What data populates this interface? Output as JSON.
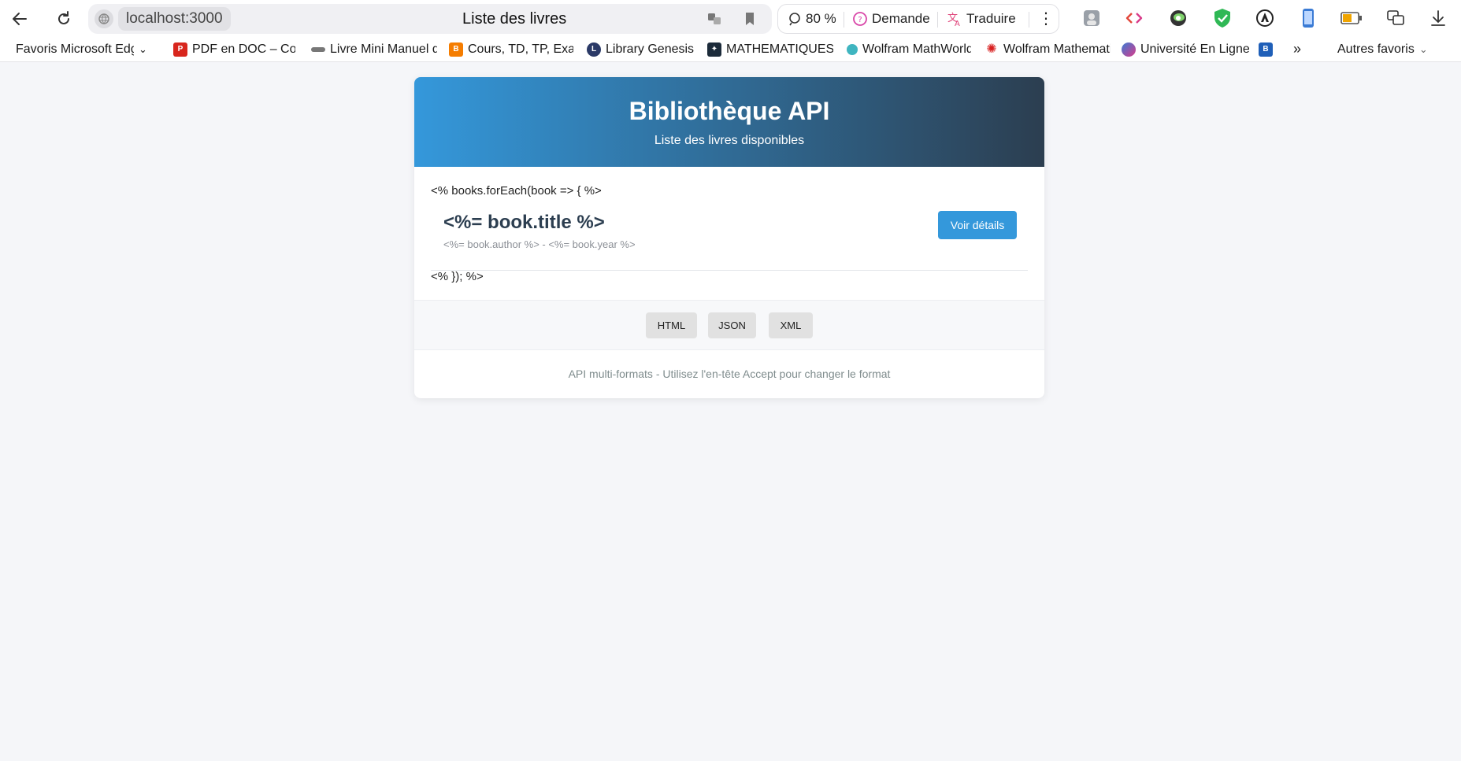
{
  "browser": {
    "url": "localhost:3000",
    "tab_title": "Liste des livres",
    "zoom": "80 %",
    "ask_label": "Demande",
    "translate_label": "Traduire"
  },
  "bookmarks": {
    "items": [
      {
        "label": "Favoris Microsoft Edge"
      },
      {
        "label": "PDF en DOC – Convertir"
      },
      {
        "label": "Livre Mini Manuel de"
      },
      {
        "label": "Cours, TD, TP, Examens"
      },
      {
        "label": "Library Genesis"
      },
      {
        "label": "MATHEMATIQUES"
      },
      {
        "label": "Wolfram MathWorld"
      },
      {
        "label": "Wolfram Mathematica"
      },
      {
        "label": "Université En Ligne"
      }
    ],
    "more_label": "»",
    "other_label": "Autres favoris"
  },
  "header": {
    "title": "Bibliothèque API",
    "subtitle": "Liste des livres disponibles"
  },
  "template": {
    "loop_start": "<% books.forEach(book => { %>",
    "loop_end": "<% }); %>"
  },
  "book": {
    "title": "<%= book.title %>",
    "meta": "<%= book.author %> - <%= book.year %>",
    "details_label": "Voir détails"
  },
  "formats": {
    "html_label": "HTML",
    "json_label": "JSON",
    "xml_label": "XML"
  },
  "footer": {
    "text": "API multi-formats - Utilisez l'en-tête Accept pour changer le format"
  }
}
